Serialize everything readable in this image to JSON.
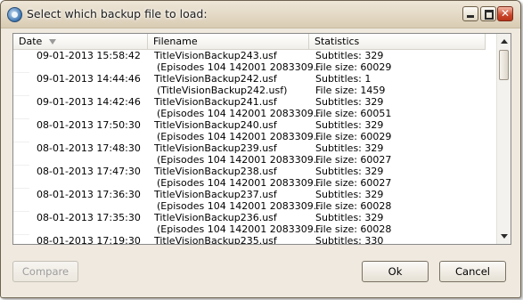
{
  "window": {
    "title": "Select which backup file to load:"
  },
  "list": {
    "columns": {
      "date": "Date",
      "filename": "Filename",
      "statistics": "Statistics"
    },
    "rows": [
      {
        "date": "09-01-2013 15:58:42",
        "file": "TitleVisionBackup243.usf",
        "file_note": "(Episodes 104 142001 2083309...",
        "subtitles": "Subtitles: 329",
        "size": "File size: 60029"
      },
      {
        "date": "09-01-2013 14:44:46",
        "file": "TitleVisionBackup242.usf",
        "file_note": "(TitleVisionBackup242.usf)",
        "subtitles": "Subtitles: 1",
        "size": "File size: 1459"
      },
      {
        "date": "09-01-2013 14:42:46",
        "file": "TitleVisionBackup241.usf",
        "file_note": "(Episodes 104 142001 2083309...",
        "subtitles": "Subtitles: 329",
        "size": "File size: 60051"
      },
      {
        "date": "08-01-2013 17:50:30",
        "file": "TitleVisionBackup240.usf",
        "file_note": "(Episodes 104 142001 2083309...",
        "subtitles": "Subtitles: 329",
        "size": "File size: 60029"
      },
      {
        "date": "08-01-2013 17:48:30",
        "file": "TitleVisionBackup239.usf",
        "file_note": "(Episodes 104 142001 2083309...",
        "subtitles": "Subtitles: 329",
        "size": "File size: 60027"
      },
      {
        "date": "08-01-2013 17:47:30",
        "file": "TitleVisionBackup238.usf",
        "file_note": "(Episodes 104 142001 2083309...",
        "subtitles": "Subtitles: 329",
        "size": "File size: 60027"
      },
      {
        "date": "08-01-2013 17:36:30",
        "file": "TitleVisionBackup237.usf",
        "file_note": "(Episodes 104 142001 2083309...",
        "subtitles": "Subtitles: 329",
        "size": "File size: 60028"
      },
      {
        "date": "08-01-2013 17:35:30",
        "file": "TitleVisionBackup236.usf",
        "file_note": "(Episodes 104 142001 2083309...",
        "subtitles": "Subtitles: 329",
        "size": "File size: 60028"
      },
      {
        "date": "08-01-2013 17:19:30",
        "file": "TitleVisionBackup235.usf",
        "file_note": "",
        "subtitles": "Subtitles: 330",
        "size": ""
      }
    ]
  },
  "buttons": {
    "compare": "Compare",
    "ok": "Ok",
    "cancel": "Cancel"
  },
  "icons": {
    "app": "app-gear-icon",
    "sort": "sort-descending-icon"
  }
}
